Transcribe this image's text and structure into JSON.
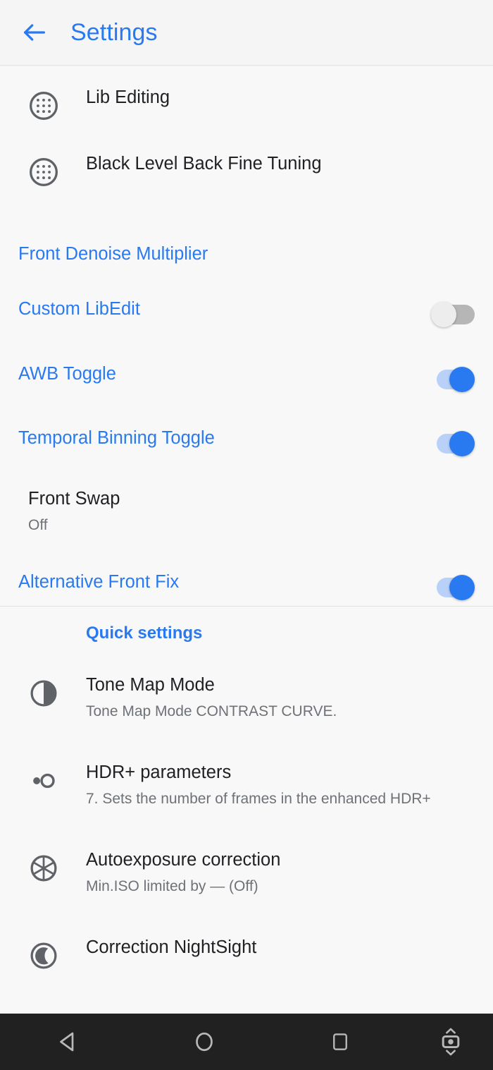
{
  "header": {
    "title": "Settings",
    "back_icon": "arrow-left-icon"
  },
  "list": {
    "items": [
      {
        "id": "lib-editing",
        "title": "Lib Editing",
        "icon": "grain-dots-icon",
        "accent": false,
        "control": "none"
      },
      {
        "id": "black-level-back-fine-tuning",
        "title": "Black Level Back Fine Tuning",
        "icon": "grain-dots-icon",
        "accent": false,
        "control": "none"
      },
      {
        "id": "front-denoise-multiplier",
        "title": "Front Denoise Multiplier",
        "icon": "none",
        "accent": true,
        "control": "none"
      },
      {
        "id": "custom-libedit",
        "title": "Custom LibEdit",
        "icon": "none",
        "accent": true,
        "control": "switch",
        "switch_state": "off"
      },
      {
        "id": "awb-toggle",
        "title": "AWB Toggle",
        "icon": "none",
        "accent": true,
        "control": "switch",
        "switch_state": "on"
      },
      {
        "id": "temporal-binning-toggle",
        "title": "Temporal Binning Toggle",
        "icon": "none",
        "accent": true,
        "control": "switch",
        "switch_state": "on"
      },
      {
        "id": "front-swap",
        "title": "Front Swap",
        "subtitle": "Off",
        "icon": "none",
        "accent": false,
        "control": "none"
      },
      {
        "id": "alternative-front-fix",
        "title": "Alternative Front Fix",
        "icon": "none",
        "accent": true,
        "control": "switch",
        "switch_state": "on"
      }
    ]
  },
  "quick_settings": {
    "section_label": "Quick settings",
    "items": [
      {
        "id": "tone-map-mode",
        "title": "Tone Map Mode",
        "subtitle": "Tone Map Mode CONTRAST CURVE.",
        "icon": "contrast-icon"
      },
      {
        "id": "hdr-plus-parameters",
        "title": "HDR+ parameters",
        "subtitle": "7. Sets the number of frames in the enhanced HDR+",
        "icon": "dot-circle-icon"
      },
      {
        "id": "autoexposure-correction",
        "title": "Autoexposure correction",
        "subtitle": "Min.ISO limited by — (Off)",
        "icon": "aperture-icon"
      },
      {
        "id": "correction-nightsight",
        "title": "Correction NightSight",
        "icon": "moon-icon"
      }
    ]
  },
  "navbar": {
    "back_label": "back-nav",
    "home_label": "home-nav",
    "recents_label": "recents-nav",
    "rotate_label": "rotation-nav"
  },
  "colors": {
    "accent": "#2979f0",
    "title_text": "#202124",
    "subtitle_text": "#6e7277",
    "background": "#f8f8f8",
    "navbar": "#212121",
    "icon_stroke": "#5f6368"
  }
}
